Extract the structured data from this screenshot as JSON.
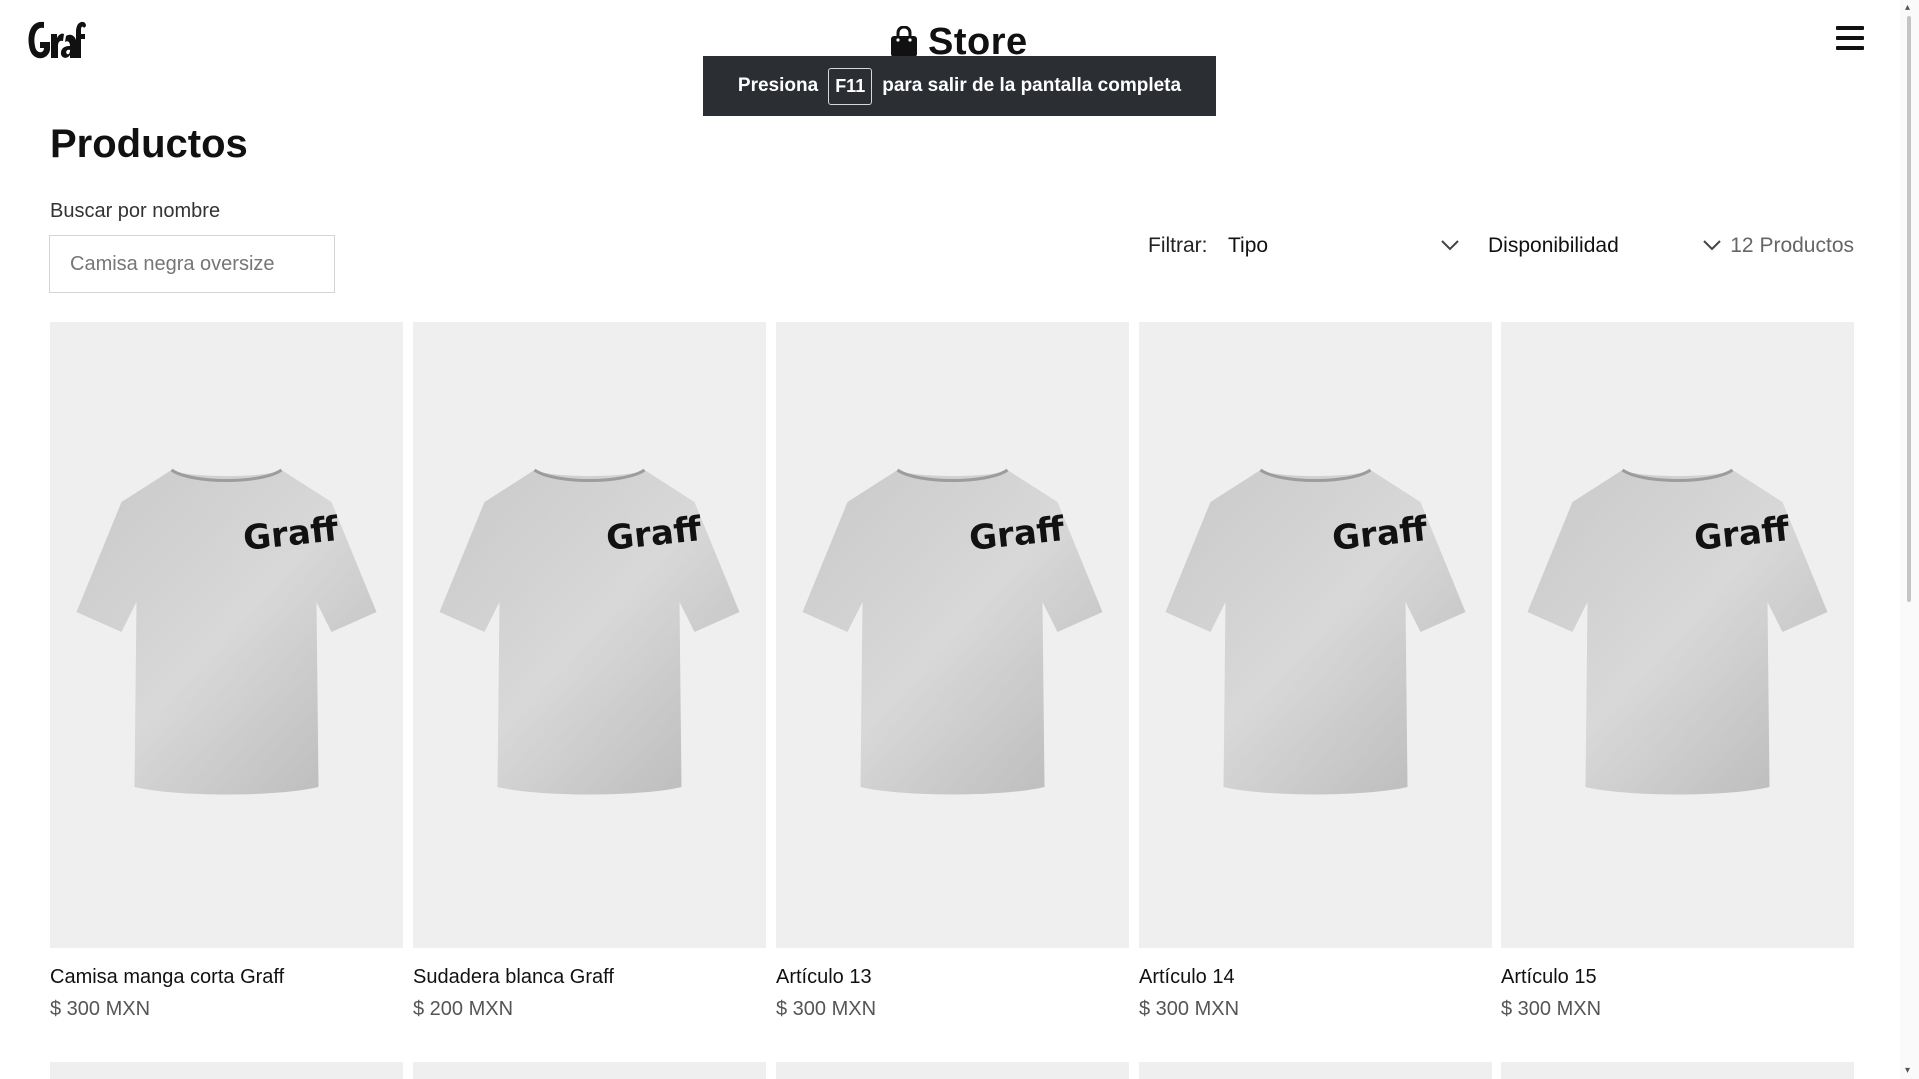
{
  "header": {
    "logo_text": "Graff",
    "brand_title": "Store",
    "bag_icon": "shopping-bag-icon",
    "menu_icon": "hamburger-menu-icon"
  },
  "fullscreen_toast": {
    "prefix": "Presiona",
    "key": "F11",
    "suffix": "para salir de la pantalla completa"
  },
  "page": {
    "title": "Productos"
  },
  "search": {
    "label": "Buscar por nombre",
    "placeholder": "Camisa negra oversize",
    "value": ""
  },
  "filters": {
    "label": "Filtrar:",
    "type_select": "Tipo",
    "availability_select": "Disponibilidad",
    "count": "12 Productos"
  },
  "products": [
    {
      "name": "Camisa manga corta Graff",
      "price": "$ 300 MXN",
      "image_icon": "tshirt-icon"
    },
    {
      "name": "Sudadera blanca Graff",
      "price": "$ 200 MXN",
      "image_icon": "tshirt-icon"
    },
    {
      "name": "Artículo 13",
      "price": "$ 300 MXN",
      "image_icon": "tshirt-icon"
    },
    {
      "name": "Artículo 14",
      "price": "$ 300 MXN",
      "image_icon": "tshirt-icon"
    },
    {
      "name": "Artículo 15",
      "price": "$ 300 MXN",
      "image_icon": "tshirt-icon"
    }
  ],
  "colors": {
    "background": "#ffffff",
    "card_bg": "#efefef",
    "toast_bg": "#2b2e33",
    "text": "#111111",
    "muted": "#666666"
  }
}
